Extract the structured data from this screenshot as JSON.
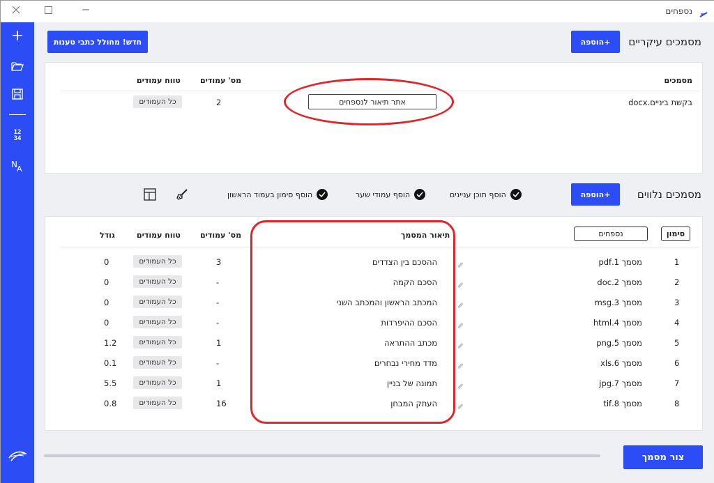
{
  "window": {
    "title": "נספחים",
    "controls": {
      "close": "close-icon",
      "maximize": "maximize-icon",
      "minimize": "minimize-icon"
    }
  },
  "sidebar": {
    "icons": [
      "plus-icon",
      "folder-icon",
      "save-icon",
      "numbering-icon",
      "text-direction-icon",
      "feather-logo-icon"
    ],
    "numbering_label_top": "12",
    "numbering_label_bottom": "34",
    "text_direction_label_n": "N",
    "text_direction_label_a": "A"
  },
  "main_docs": {
    "title": "מסמכים עיקריים",
    "add_button": "+הוספה",
    "new_from_wizard_button": "חדש! מחולל כתבי טענות",
    "headers": {
      "documents": "מסמכים",
      "page_count": "מס' עמודים",
      "page_range": "טווח עמודים"
    },
    "rows": [
      {
        "name": "בקשת ביניים.docx",
        "description_button": "אתר תיאור לנספחים",
        "pages": "2",
        "range": "כל העמודים"
      }
    ]
  },
  "attachments": {
    "title": "מסמכים נלווים",
    "add_button": "+הוספה",
    "options": [
      {
        "label": "הוסף תוכן עניינים",
        "checked": true
      },
      {
        "label": "הוסף עמודי שער",
        "checked": true
      },
      {
        "label": "הוסף סימון בעמוד הראשון",
        "checked": true
      }
    ],
    "toolbar_icons": [
      "brush-icon",
      "table-icon"
    ],
    "headers": {
      "mark": "סימון",
      "annexes": "נספחים",
      "description": "תיאור המסמך",
      "page_count": "מס' עמודים",
      "page_range": "טווח עמודים",
      "size": "גודל"
    },
    "rows": [
      {
        "mark": "1",
        "name": "מסמך 1.pdf",
        "description": "ההסכם בין הצדדים",
        "pages": "3",
        "range": "כל העמודים",
        "size": "0"
      },
      {
        "mark": "2",
        "name": "מסמך 2.doc",
        "description": "הסכם הקמה",
        "pages": "-",
        "range": "כל העמודים",
        "size": "0"
      },
      {
        "mark": "3",
        "name": "מסמך 3.msg",
        "description": "המכתב הראשון והמכתב השני",
        "pages": "-",
        "range": "כל העמודים",
        "size": "0"
      },
      {
        "mark": "4",
        "name": "מסמך 4.html",
        "description": "הסכם ההיפרדות",
        "pages": "-",
        "range": "כל העמודים",
        "size": "0"
      },
      {
        "mark": "5",
        "name": "מסמך 5.png",
        "description": "מכתב ההתראה",
        "pages": "1",
        "range": "כל העמודים",
        "size": "1.2"
      },
      {
        "mark": "6",
        "name": "מסמך 6.xls",
        "description": "מדד מחירי נבחרים",
        "pages": "-",
        "range": "כל העמודים",
        "size": "0.1"
      },
      {
        "mark": "7",
        "name": "מסמך 7.jpg",
        "description": "תמונה של בניין",
        "pages": "1",
        "range": "כל העמודים",
        "size": "5.5"
      },
      {
        "mark": "8",
        "name": "מסמך 8.tif",
        "description": "העתק המבחן",
        "pages": "16",
        "range": "כל העמודים",
        "size": "0.8"
      }
    ]
  },
  "footer": {
    "create_button": "צור מסמך"
  },
  "colors": {
    "accent": "#2c4cf5",
    "highlight": "#e0262b",
    "background": "#eef0f4"
  }
}
